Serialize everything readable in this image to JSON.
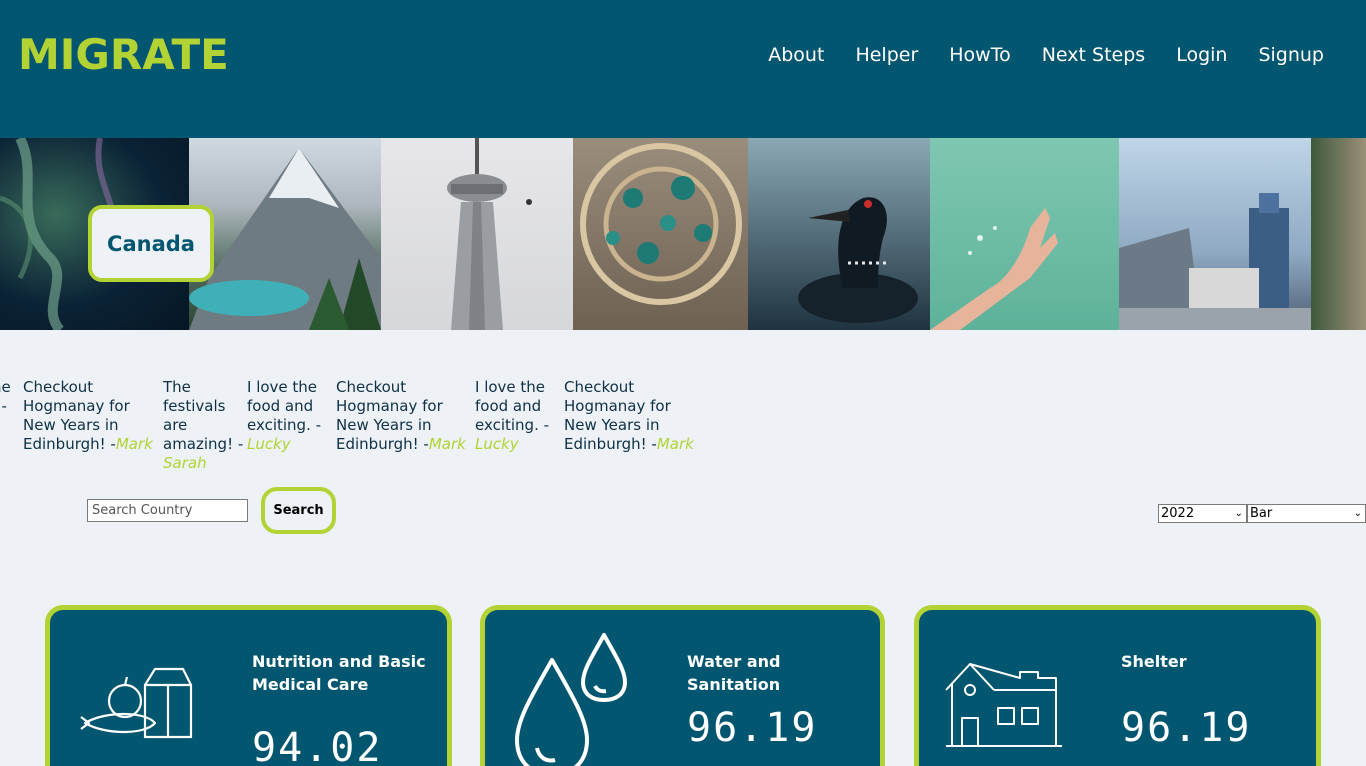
{
  "header": {
    "logo": "MIGRATE",
    "nav": [
      "About",
      "Helper",
      "HowTo",
      "Next Steps",
      "Login",
      "Signup"
    ]
  },
  "banner": {
    "country": "Canada"
  },
  "testimonials": [
    {
      "text": "he\n. -",
      "author": ""
    },
    {
      "text": "Checkout\nHogmanay for\nNew Years in\nEdinburgh! -",
      "author": "Mark"
    },
    {
      "text": "The\nfestivals\nare\namazing! -",
      "author": "Sarah"
    },
    {
      "text": "I love the\nfood and\nexciting. -",
      "author": "Lucky"
    },
    {
      "text": "Checkout\nHogmanay for\nNew Years in\nEdinburgh! -",
      "author": "Mark"
    },
    {
      "text": "I love the\nfood and\nexciting. -",
      "author": "Lucky"
    },
    {
      "text": "Checkout\nHogmanay for\nNew Years in\nEdinburgh! -",
      "author": "Mark"
    }
  ],
  "search": {
    "placeholder": "Search Country",
    "button": "Search"
  },
  "controls": {
    "year": "2022",
    "chart_type": "Bar"
  },
  "cards": [
    {
      "title": "Nutrition and Basic Medical Care",
      "value": "94.02",
      "icon": "food-icon"
    },
    {
      "title": "Water and Sanitation",
      "value": "96.19",
      "icon": "water-drops-icon"
    },
    {
      "title": "Shelter",
      "value": "96.19",
      "icon": "house-icon"
    }
  ],
  "colors": {
    "primary": "#03566f",
    "accent": "#b3d234",
    "background": "#eef2f7"
  }
}
